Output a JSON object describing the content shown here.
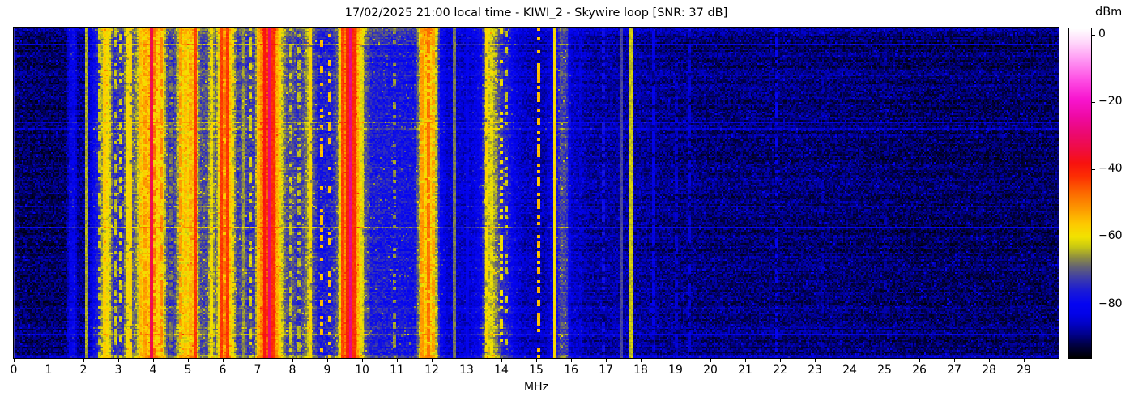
{
  "figure": {
    "title": "17/02/2025 21:00 local time - KIWI_2 - Skywire loop [SNR: 37 dB]"
  },
  "chart_data": {
    "type": "heatmap",
    "subtype": "radio-spectrum-waterfall",
    "title": "17/02/2025 21:00 local time - KIWI_2 - Skywire loop [SNR: 37 dB]",
    "xlabel": "MHz",
    "x_range": [
      0,
      30
    ],
    "x_ticks": [
      0,
      1,
      2,
      3,
      4,
      5,
      6,
      7,
      8,
      9,
      10,
      11,
      12,
      13,
      14,
      15,
      16,
      17,
      18,
      19,
      20,
      21,
      22,
      23,
      24,
      25,
      26,
      27,
      28,
      29
    ],
    "y_axis": {
      "ticks": []
    },
    "colorbar": {
      "label": "dBm",
      "vmax": 2,
      "vmin": -96,
      "ticks": [
        {
          "v": 0,
          "label": "0"
        },
        {
          "v": -20,
          "label": "−20"
        },
        {
          "v": -40,
          "label": "−40"
        },
        {
          "v": -60,
          "label": "−60"
        },
        {
          "v": -80,
          "label": "−80"
        }
      ]
    },
    "colormap_stops": [
      [
        -96,
        "#000000"
      ],
      [
        -92,
        "#000048"
      ],
      [
        -89,
        "#01018c"
      ],
      [
        -86,
        "#0202c4"
      ],
      [
        -83,
        "#0303e8"
      ],
      [
        -80,
        "#0505f2"
      ],
      [
        -76,
        "#1b1bd6"
      ],
      [
        -72,
        "#4140a5"
      ],
      [
        -69,
        "#646374"
      ],
      [
        -66,
        "#91913f"
      ],
      [
        -63,
        "#c9c913"
      ],
      [
        -60,
        "#f2e300"
      ],
      [
        -56,
        "#fec800"
      ],
      [
        -52,
        "#fd9c00"
      ],
      [
        -47,
        "#fc6a00"
      ],
      [
        -42,
        "#fd2e03"
      ],
      [
        -38,
        "#f8120f"
      ],
      [
        -34,
        "#f00d41"
      ],
      [
        -29,
        "#ec0973"
      ],
      [
        -24,
        "#ef0aa6"
      ],
      [
        -19,
        "#f815cf"
      ],
      [
        -13,
        "#fe51e5"
      ],
      [
        -7,
        "#ff9bf4"
      ],
      [
        -2,
        "#ffd9fb"
      ],
      [
        2,
        "#ffffff"
      ]
    ],
    "baseline_profile_dbm": [
      [
        0,
        -90
      ],
      [
        0.1,
        -91
      ],
      [
        1.5,
        -91
      ],
      [
        1.6,
        -83
      ],
      [
        1.75,
        -81
      ],
      [
        1.85,
        -89
      ],
      [
        2.0,
        -89
      ],
      [
        2.12,
        -88
      ],
      [
        2.3,
        -80
      ],
      [
        2.42,
        -76
      ],
      [
        2.55,
        -64
      ],
      [
        2.62,
        -60
      ],
      [
        2.75,
        -61
      ],
      [
        2.85,
        -74
      ],
      [
        3.0,
        -73
      ],
      [
        3.12,
        -75
      ],
      [
        3.2,
        -66
      ],
      [
        3.3,
        -62
      ],
      [
        3.4,
        -70
      ],
      [
        3.5,
        -68
      ],
      [
        3.58,
        -62
      ],
      [
        3.7,
        -58
      ],
      [
        3.85,
        -56
      ],
      [
        4.0,
        -56
      ],
      [
        4.15,
        -57
      ],
      [
        4.3,
        -60
      ],
      [
        4.42,
        -73
      ],
      [
        4.6,
        -73
      ],
      [
        4.72,
        -65
      ],
      [
        4.82,
        -59
      ],
      [
        5.0,
        -59
      ],
      [
        5.12,
        -55
      ],
      [
        5.25,
        -60
      ],
      [
        5.35,
        -71
      ],
      [
        5.55,
        -71
      ],
      [
        5.62,
        -64
      ],
      [
        5.7,
        -62
      ],
      [
        5.78,
        -70
      ],
      [
        5.85,
        -64
      ],
      [
        5.92,
        -55
      ],
      [
        6.05,
        -53
      ],
      [
        6.2,
        -55
      ],
      [
        6.32,
        -65
      ],
      [
        6.45,
        -73
      ],
      [
        6.6,
        -69
      ],
      [
        6.72,
        -73
      ],
      [
        6.9,
        -72
      ],
      [
        7.0,
        -60
      ],
      [
        7.1,
        -50
      ],
      [
        7.2,
        -45
      ],
      [
        7.35,
        -44
      ],
      [
        7.5,
        -50
      ],
      [
        7.62,
        -58
      ],
      [
        7.72,
        -64
      ],
      [
        7.85,
        -72
      ],
      [
        8.0,
        -70
      ],
      [
        8.15,
        -74
      ],
      [
        8.35,
        -70
      ],
      [
        8.48,
        -62
      ],
      [
        8.6,
        -70
      ],
      [
        8.75,
        -77
      ],
      [
        9.1,
        -76
      ],
      [
        9.3,
        -70
      ],
      [
        9.4,
        -55
      ],
      [
        9.5,
        -49
      ],
      [
        9.65,
        -47
      ],
      [
        9.8,
        -49
      ],
      [
        9.9,
        -55
      ],
      [
        10.0,
        -63
      ],
      [
        10.1,
        -70
      ],
      [
        10.25,
        -76
      ],
      [
        10.8,
        -77
      ],
      [
        11.5,
        -78
      ],
      [
        11.62,
        -68
      ],
      [
        11.72,
        -59
      ],
      [
        11.88,
        -56
      ],
      [
        12.02,
        -58
      ],
      [
        12.12,
        -64
      ],
      [
        12.25,
        -80
      ],
      [
        12.45,
        -85
      ],
      [
        13.1,
        -85
      ],
      [
        13.42,
        -80
      ],
      [
        13.52,
        -68
      ],
      [
        13.62,
        -62
      ],
      [
        13.78,
        -64
      ],
      [
        13.9,
        -70
      ],
      [
        14.0,
        -74
      ],
      [
        14.2,
        -77
      ],
      [
        14.4,
        -83
      ],
      [
        14.6,
        -86
      ],
      [
        15.25,
        -87
      ],
      [
        15.5,
        -82
      ],
      [
        15.62,
        -76
      ],
      [
        15.72,
        -71
      ],
      [
        15.88,
        -73
      ],
      [
        16.0,
        -85
      ],
      [
        16.6,
        -88
      ],
      [
        17.2,
        -88
      ],
      [
        17.75,
        -88
      ],
      [
        18.5,
        -89
      ],
      [
        20,
        -90
      ],
      [
        23,
        -90
      ],
      [
        26,
        -91
      ],
      [
        30,
        -91
      ]
    ],
    "carriers_dbm": [
      {
        "f": 0.02,
        "level": -73,
        "w": 0.04,
        "duty": 1
      },
      {
        "f": 2.08,
        "level": -65,
        "w": 0.015,
        "duty": 1
      },
      {
        "f": 2.45,
        "level": -63,
        "w": 0.02,
        "duty": 0.6
      },
      {
        "f": 2.6,
        "level": -57,
        "w": 0.02,
        "duty": 0.8
      },
      {
        "f": 2.68,
        "level": -60,
        "w": 0.02,
        "duty": 0.7
      },
      {
        "f": 2.95,
        "level": -63,
        "w": 0.02,
        "duty": 0.55
      },
      {
        "f": 3.06,
        "level": -62,
        "w": 0.02,
        "duty": 0.5
      },
      {
        "f": 3.25,
        "level": -59,
        "w": 0.02,
        "duty": 0.8
      },
      {
        "f": 3.33,
        "level": -58,
        "w": 0.015,
        "duty": 0.9
      },
      {
        "f": 3.64,
        "level": -55,
        "w": 0.02,
        "duty": 0.8
      },
      {
        "f": 3.78,
        "level": -52,
        "w": 0.03,
        "duty": 0.7
      },
      {
        "f": 3.95,
        "level": -33,
        "w": 0.02,
        "duty": 1
      },
      {
        "f": 4.06,
        "level": -48,
        "w": 0.02,
        "duty": 0.6
      },
      {
        "f": 4.25,
        "level": -50,
        "w": 0.025,
        "duty": 0.6
      },
      {
        "f": 4.5,
        "level": -68,
        "w": 0.02,
        "duty": 0.4
      },
      {
        "f": 4.8,
        "level": -52,
        "w": 0.025,
        "duty": 0.7
      },
      {
        "f": 4.94,
        "level": -55,
        "w": 0.02,
        "duty": 0.6
      },
      {
        "f": 5.06,
        "level": -53,
        "w": 0.02,
        "duty": 0.6
      },
      {
        "f": 5.2,
        "level": -43,
        "w": 0.02,
        "duty": 1
      },
      {
        "f": 5.66,
        "level": -60,
        "w": 0.025,
        "duty": 0.7
      },
      {
        "f": 5.94,
        "level": -43,
        "w": 0.022,
        "duty": 1
      },
      {
        "f": 6.06,
        "level": -48,
        "w": 0.02,
        "duty": 0.7
      },
      {
        "f": 6.16,
        "level": -43,
        "w": 0.022,
        "duty": 1
      },
      {
        "f": 6.3,
        "level": -58,
        "w": 0.02,
        "duty": 0.5
      },
      {
        "f": 6.6,
        "level": -66,
        "w": 0.015,
        "duty": 0.9
      },
      {
        "f": 6.8,
        "level": -62,
        "w": 0.02,
        "duty": 0.5
      },
      {
        "f": 7.0,
        "level": -55,
        "w": 0.03,
        "duty": 0.8
      },
      {
        "f": 7.22,
        "level": -39,
        "w": 0.03,
        "duty": 1
      },
      {
        "f": 7.37,
        "level": -30,
        "w": 0.025,
        "duty": 1
      },
      {
        "f": 7.45,
        "level": -42,
        "w": 0.02,
        "duty": 1
      },
      {
        "f": 7.6,
        "level": -55,
        "w": 0.03,
        "duty": 0.8
      },
      {
        "f": 7.95,
        "level": -63,
        "w": 0.02,
        "duty": 0.5
      },
      {
        "f": 8.2,
        "level": -64,
        "w": 0.02,
        "duty": 0.5
      },
      {
        "f": 8.5,
        "level": -58,
        "w": 0.035,
        "duty": 0.85
      },
      {
        "f": 8.85,
        "level": -55,
        "w": 0.03,
        "duty": 0.35
      },
      {
        "f": 9.05,
        "level": -56,
        "w": 0.03,
        "duty": 0.35
      },
      {
        "f": 9.42,
        "level": -44,
        "w": 0.025,
        "duty": 1
      },
      {
        "f": 9.58,
        "level": -40,
        "w": 0.03,
        "duty": 1
      },
      {
        "f": 9.68,
        "level": -28,
        "w": 0.02,
        "duty": 1
      },
      {
        "f": 9.78,
        "level": -42,
        "w": 0.025,
        "duty": 1
      },
      {
        "f": 10.0,
        "level": -62,
        "w": 0.03,
        "duty": 0.9
      },
      {
        "f": 10.95,
        "level": -66,
        "w": 0.02,
        "duty": 0.3
      },
      {
        "f": 11.73,
        "level": -52,
        "w": 0.03,
        "duty": 0.8
      },
      {
        "f": 11.9,
        "level": -48,
        "w": 0.03,
        "duty": 0.85
      },
      {
        "f": 12.06,
        "level": -53,
        "w": 0.03,
        "duty": 0.7
      },
      {
        "f": 12.65,
        "level": -68,
        "w": 0.012,
        "duty": 1
      },
      {
        "f": 13.0,
        "level": -82,
        "w": 0.015,
        "duty": 0.8
      },
      {
        "f": 13.57,
        "level": -58,
        "w": 0.02,
        "duty": 0.8
      },
      {
        "f": 13.72,
        "level": -61,
        "w": 0.02,
        "duty": 0.6
      },
      {
        "f": 14.02,
        "level": -60,
        "w": 0.02,
        "duty": 0.35
      },
      {
        "f": 14.12,
        "level": -63,
        "w": 0.02,
        "duty": 0.3
      },
      {
        "f": 15.05,
        "level": -55,
        "w": 0.03,
        "duty": 0.55
      },
      {
        "f": 15.55,
        "level": -58,
        "w": 0.015,
        "duty": 1
      },
      {
        "f": 16.3,
        "level": -84,
        "w": 0.02,
        "duty": 0.6
      },
      {
        "f": 16.95,
        "level": -78,
        "w": 0.015,
        "duty": 0.5
      },
      {
        "f": 17.45,
        "level": -72,
        "w": 0.012,
        "duty": 1
      },
      {
        "f": 17.7,
        "level": -63,
        "w": 0.015,
        "duty": 1
      },
      {
        "f": 18.35,
        "level": -83,
        "w": 0.015,
        "duty": 0.7
      },
      {
        "f": 19.0,
        "level": -85,
        "w": 0.015,
        "duty": 0.5
      },
      {
        "f": 19.4,
        "level": -84,
        "w": 0.012,
        "duty": 0.6
      },
      {
        "f": 21.9,
        "level": -81,
        "w": 0.015,
        "duty": 0.4
      },
      {
        "f": 23.2,
        "level": -87,
        "w": 0.012,
        "duty": 0.4
      },
      {
        "f": 25.0,
        "level": -88,
        "w": 0.012,
        "duty": 0.3
      }
    ],
    "texture": {
      "seed": 42,
      "pixel_noise_db": 7,
      "speckle_prob": 0.035,
      "speckle_boost_db": 7,
      "row_jitter_db": 3,
      "row_streak_prob": 0.07,
      "row_streak_db": 6
    }
  }
}
